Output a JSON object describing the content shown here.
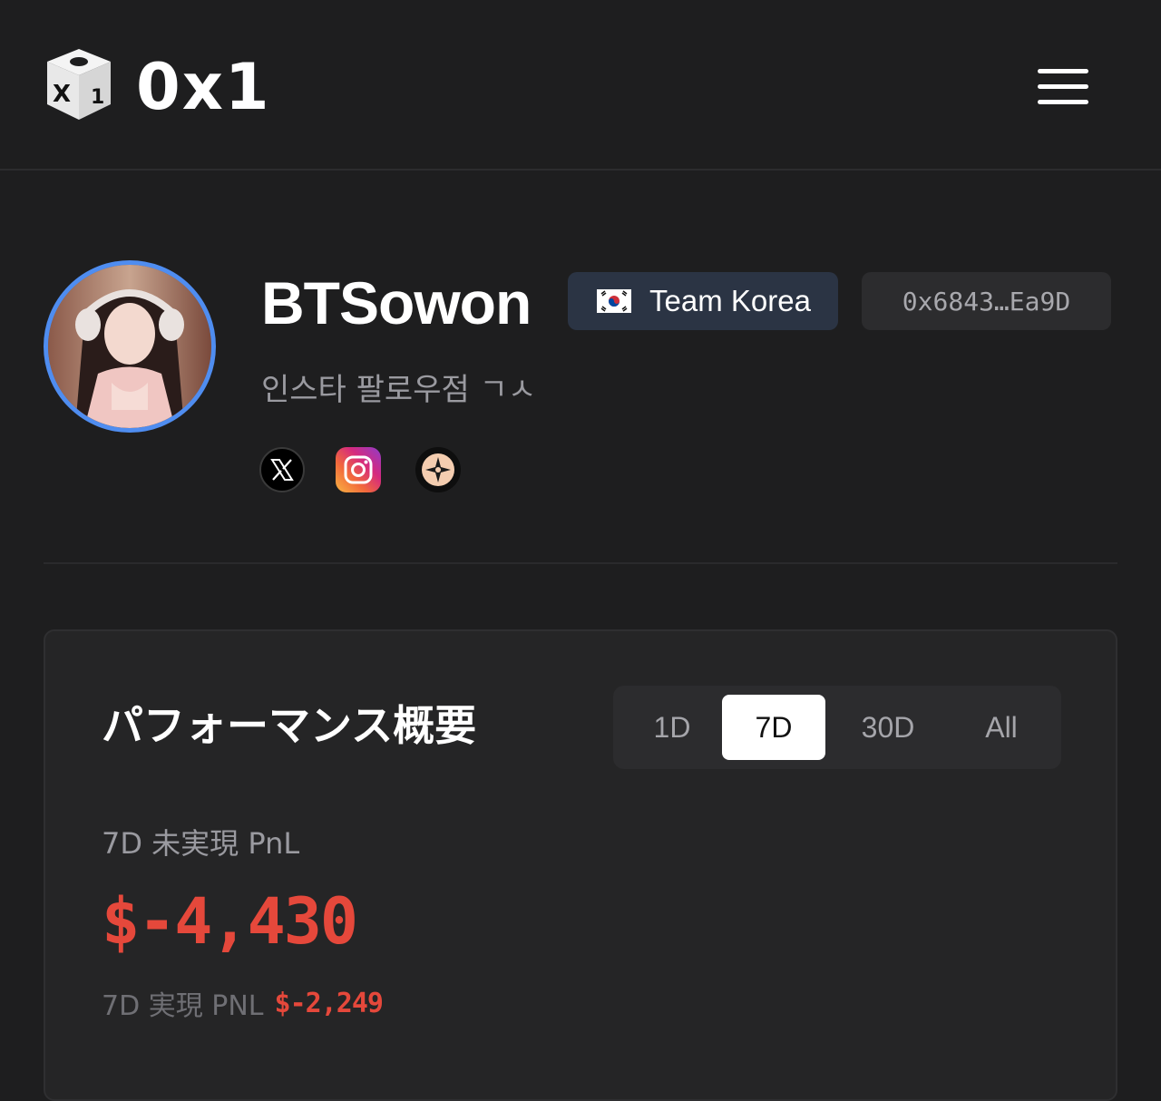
{
  "header": {
    "logo_text": "0x1",
    "logo_dice_faces": [
      "X",
      "1"
    ],
    "menu_icon": "hamburger-menu-icon"
  },
  "profile": {
    "username": "BTSowon",
    "team": {
      "flag_icon": "south-korea-flag-icon",
      "label": "Team Korea"
    },
    "address": "0x6843…Ea9D",
    "bio": "인스타 팔로우점 ㄱㅅ",
    "socials": [
      {
        "name": "x-icon"
      },
      {
        "name": "instagram-icon"
      },
      {
        "name": "community-icon"
      }
    ]
  },
  "performance": {
    "title": "パフォーマンス概要",
    "tabs": [
      {
        "label": "1D",
        "active": false
      },
      {
        "label": "7D",
        "active": true
      },
      {
        "label": "30D",
        "active": false
      },
      {
        "label": "All",
        "active": false
      }
    ],
    "unrealized_label": "7D 未実現 PnL",
    "unrealized_value": "$-4,430",
    "realized_label": "7D 実現 PNL",
    "realized_value": "$-2,249"
  },
  "colors": {
    "background": "#1e1e1f",
    "card": "#252526",
    "loss_red": "#e5483b",
    "avatar_ring": "#4f8df0",
    "team_badge": "#2b3444"
  }
}
